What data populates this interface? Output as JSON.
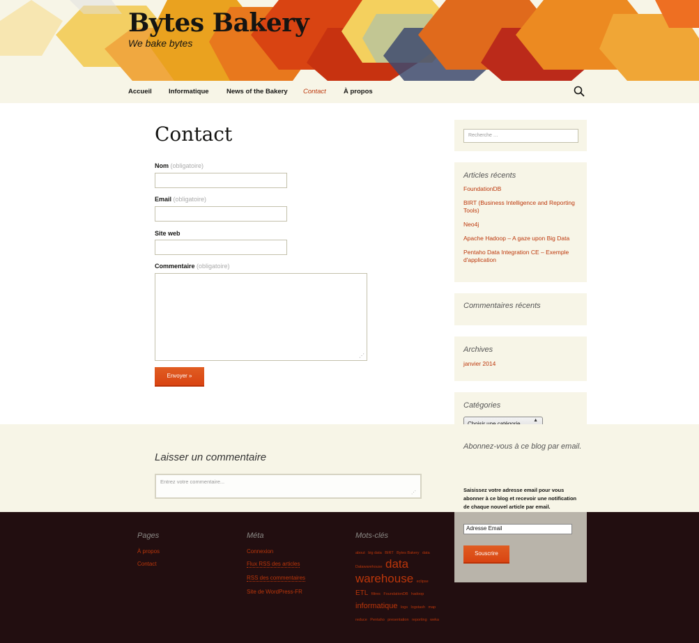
{
  "site": {
    "title": "Bytes Bakery",
    "description": "We bake bytes"
  },
  "nav": {
    "items": [
      {
        "label": "Accueil"
      },
      {
        "label": "Informatique"
      },
      {
        "label": "News of the Bakery"
      },
      {
        "label": "Contact",
        "active": true
      },
      {
        "label": "À propos"
      }
    ],
    "search_icon": "search-icon"
  },
  "main": {
    "title": "Contact",
    "fields": {
      "name_label": "Nom",
      "email_label": "Email",
      "website_label": "Site web",
      "comment_label": "Commentaire",
      "required_note": "(obligatoire)"
    },
    "submit_label": "Envoyer »"
  },
  "sidebar": {
    "search_placeholder": "Recherche …",
    "recent_posts": {
      "title": "Articles récents",
      "items": [
        "FoundationDB",
        "BIRT (Business Intelligence and Reporting Tools)",
        "Neo4j",
        "Apache Hadoop – A gaze upon Big Data",
        "Pentaho Data Integration CE – Exemple d'application"
      ]
    },
    "recent_comments": {
      "title": "Commentaires récents"
    },
    "archives": {
      "title": "Archives",
      "items": [
        "janvier 2014"
      ]
    },
    "categories": {
      "title": "Catégories",
      "select_value": "Choisir une catégorie"
    }
  },
  "comment_form": {
    "title": "Laisser un commentaire",
    "placeholder": "Entrez votre commentaire..."
  },
  "subscribe": {
    "title": "Abonnez-vous à ce blog par email.",
    "description": "Saisissez votre adresse email pour vous abonner à ce blog et recevoir une notification de chaque nouvel article par email.",
    "email_placeholder": "Adresse Email",
    "button_label": "Souscrire"
  },
  "footer": {
    "pages": {
      "title": "Pages",
      "items": [
        "À propos",
        "Contact"
      ]
    },
    "meta": {
      "title": "Méta",
      "items": [
        "Connexion",
        "Flux RSS des articles",
        "RSS des commentaires",
        "Site de WordPress-FR"
      ]
    },
    "tags": {
      "title": "Mots-clés",
      "items": [
        {
          "label": "about"
        },
        {
          "label": "big data"
        },
        {
          "label": "BIRT"
        },
        {
          "label": "Bytes Bakery"
        },
        {
          "label": "data"
        },
        {
          "label": "Datawarehouse"
        },
        {
          "label": "data warehouse"
        },
        {
          "label": "eclipse"
        },
        {
          "label": "ETL"
        },
        {
          "label": "filtres"
        },
        {
          "label": "FoundationDB"
        },
        {
          "label": "hadoop"
        },
        {
          "label": "informatique"
        },
        {
          "label": "logs"
        },
        {
          "label": "logstash"
        },
        {
          "label": "map reduce"
        },
        {
          "label": "Pentaho"
        },
        {
          "label": "presentation"
        },
        {
          "label": "reporting"
        },
        {
          "label": "weka"
        }
      ]
    }
  },
  "colors": {
    "accent": "#bc360a",
    "button": "#d94412",
    "header_bg": "#f7f5e7",
    "footer_bg": "#220e10"
  }
}
